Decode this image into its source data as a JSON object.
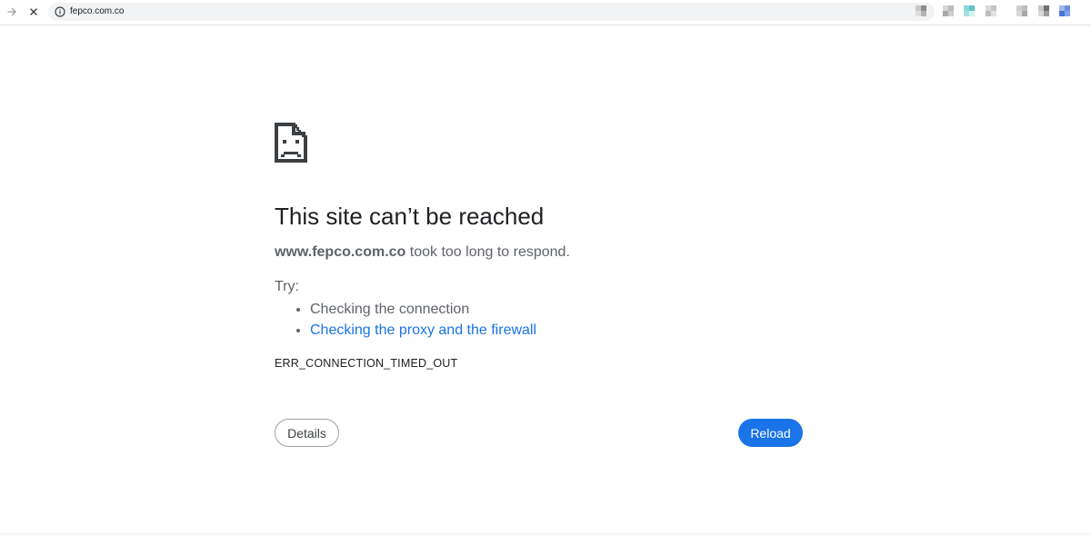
{
  "toolbar": {
    "back_icon": "arrow-right-icon",
    "stop_icon": "close-icon",
    "site_info_icon": "info-circle-icon",
    "url": "fepco.com.co",
    "extensions": [
      {
        "name": "extension-icon-1",
        "colors": [
          "#c9c9c9",
          "#8d8d8d",
          "#dedede",
          "#b3b3b3"
        ]
      },
      {
        "name": "extension-icon-2",
        "colors": [
          "#d6d6d6",
          "#bdbdbd",
          "#a9a9a9",
          "#cfcfcf"
        ]
      },
      {
        "name": "extension-icon-3",
        "colors": [
          "#8fd7d7",
          "#5cc6c8",
          "#a6dfe0",
          "#d5efef"
        ]
      },
      {
        "name": "extension-icon-4",
        "colors": [
          "#d9d9d9",
          "#c4c4c4",
          "#bfbfbf",
          "#e3e3e3"
        ]
      },
      {
        "name": "extension-icon-5",
        "colors": [
          "#cfcfcf",
          "#bdbdbd",
          "#d9d9d9",
          "#a8a8a8"
        ]
      },
      {
        "name": "extension-icon-6",
        "colors": [
          "#c7c7c7",
          "#6e6e6e",
          "#d8d8d8",
          "#9a9a9a"
        ]
      },
      {
        "name": "extension-icon-7",
        "colors": [
          "#9fb9ee",
          "#6b8fe0",
          "#4a73d6",
          "#7fa2e8"
        ]
      }
    ]
  },
  "error_page": {
    "icon": "sad-page-icon",
    "title": "This site can’t be reached",
    "host": "www.fepco.com.co",
    "summary_rest": " took too long to respond.",
    "try_label": "Try:",
    "suggestions": [
      {
        "label": "Checking the connection",
        "is_link": false
      },
      {
        "label": "Checking the proxy and the firewall",
        "is_link": true
      }
    ],
    "error_code": "ERR_CONNECTION_TIMED_OUT",
    "details_label": "Details",
    "reload_label": "Reload",
    "colors": {
      "link": "#1a73e8",
      "primary_button": "#1a73e8",
      "body_text": "#5f6368",
      "title_text": "#202124"
    }
  }
}
